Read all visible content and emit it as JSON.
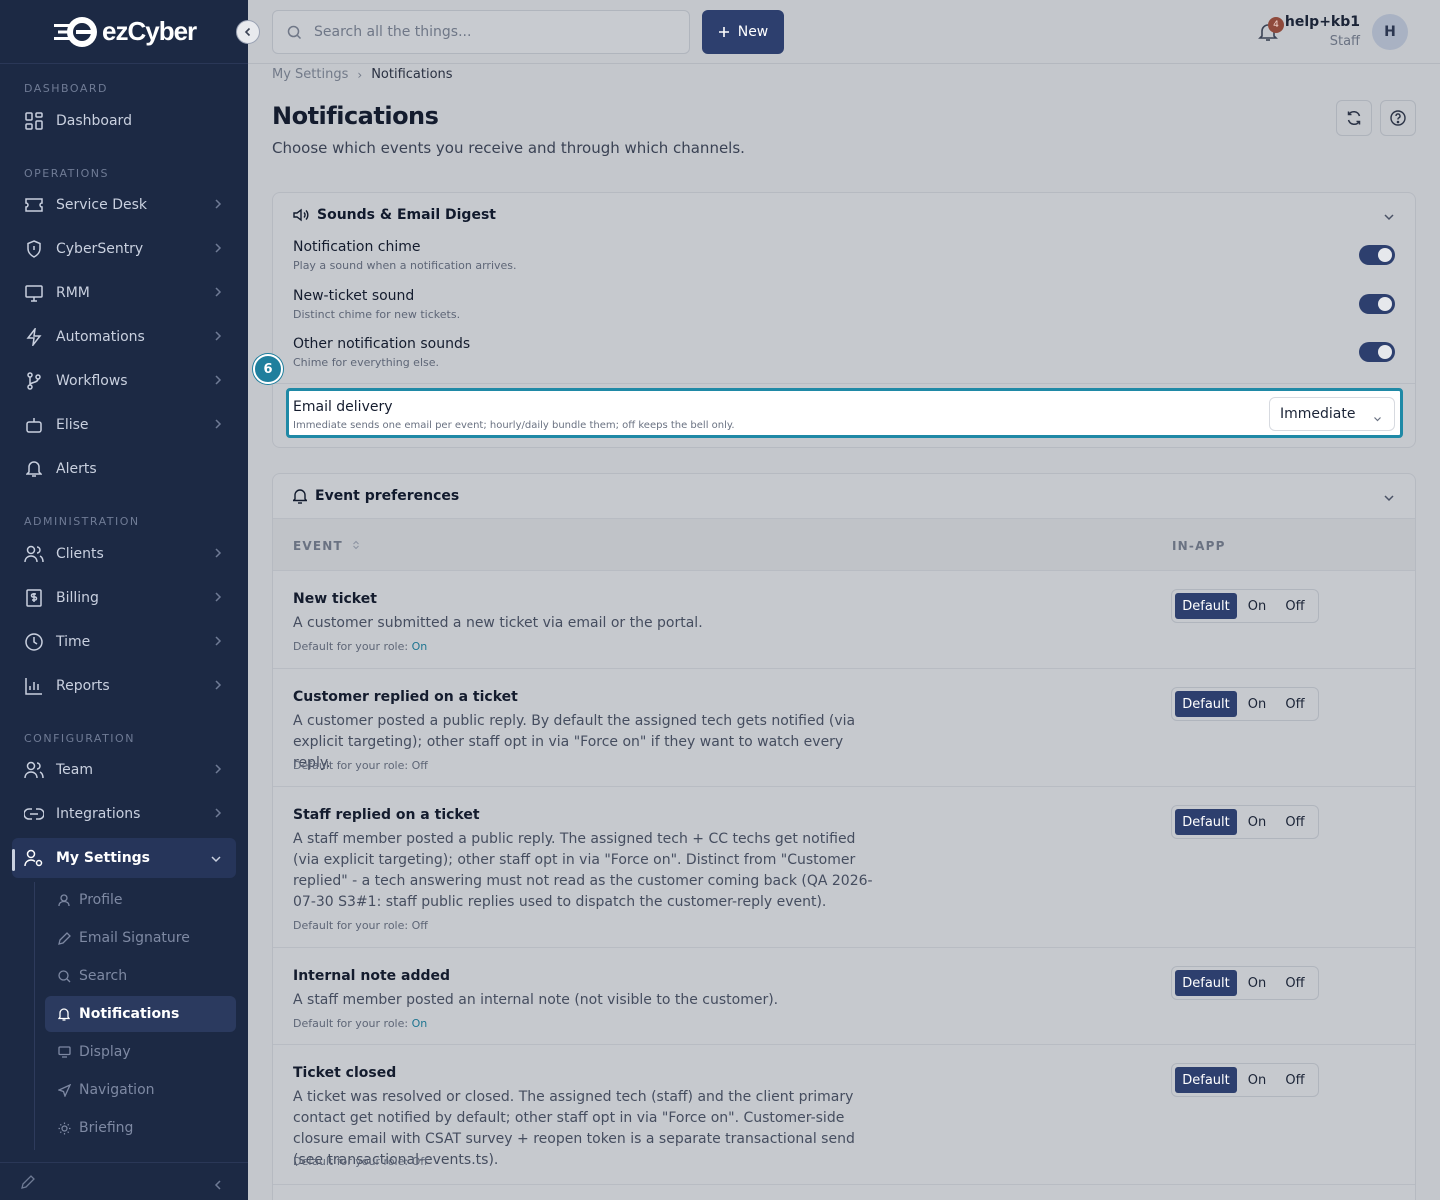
{
  "brand": {
    "name": "ezCyber"
  },
  "sidebar": {
    "sections": [
      {
        "label": "DASHBOARD"
      },
      {
        "label": "OPERATIONS"
      },
      {
        "label": "ADMINISTRATION"
      },
      {
        "label": "CONFIGURATION"
      }
    ],
    "items": [
      {
        "label": "Dashboard",
        "icon": "grid-icon"
      },
      {
        "label": "Service Desk",
        "icon": "ticket-icon"
      },
      {
        "label": "CyberSentry",
        "icon": "shield-icon"
      },
      {
        "label": "RMM",
        "icon": "monitor-icon"
      },
      {
        "label": "Automations",
        "icon": "bolt-icon"
      },
      {
        "label": "Workflows",
        "icon": "branch-icon"
      },
      {
        "label": "Elise",
        "icon": "bot-icon"
      },
      {
        "label": "Alerts",
        "icon": "bell-icon"
      },
      {
        "label": "Clients",
        "icon": "users-icon"
      },
      {
        "label": "Billing",
        "icon": "dollar-icon"
      },
      {
        "label": "Time",
        "icon": "clock-icon"
      },
      {
        "label": "Reports",
        "icon": "bar-chart-icon"
      },
      {
        "label": "Team",
        "icon": "team-icon"
      },
      {
        "label": "Integrations",
        "icon": "link-icon"
      },
      {
        "label": "My Settings",
        "icon": "user-cog-icon"
      }
    ],
    "subitems": [
      {
        "label": "Profile",
        "icon": "user-icon"
      },
      {
        "label": "Email Signature",
        "icon": "pen-icon"
      },
      {
        "label": "Search",
        "icon": "search-icon"
      },
      {
        "label": "Notifications",
        "icon": "bell-icon"
      },
      {
        "label": "Display",
        "icon": "display-icon"
      },
      {
        "label": "Navigation",
        "icon": "send-icon"
      },
      {
        "label": "Briefing",
        "icon": "sun-icon"
      }
    ]
  },
  "topbar": {
    "search_placeholder": "Search all the things...",
    "new_label": "New",
    "notification_count": "4",
    "user_name": "help+kb1",
    "user_role": "Staff",
    "avatar_initial": "H"
  },
  "breadcrumb": {
    "parent": "My Settings",
    "current": "Notifications"
  },
  "page": {
    "title": "Notifications",
    "subtitle": "Choose which events you receive and through which channels."
  },
  "sounds": {
    "title": "Sounds & Email Digest",
    "settings": [
      {
        "title": "Notification chime",
        "desc": "Play a sound when a notification arrives.",
        "enabled": true
      },
      {
        "title": "New-ticket sound",
        "desc": "Distinct chime for new tickets.",
        "enabled": true
      },
      {
        "title": "Other notification sounds",
        "desc": "Chime for everything else.",
        "enabled": true
      }
    ],
    "email": {
      "title": "Email delivery",
      "desc": "Immediate sends one email per event; hourly/daily bundle them; off keeps the bell only.",
      "value": "Immediate"
    },
    "step_marker": "6"
  },
  "events": {
    "title": "Event preferences",
    "col_event": "EVENT",
    "col_inapp": "IN-APP",
    "options": {
      "default": "Default",
      "on": "On",
      "off": "Off"
    },
    "rows": [
      {
        "title": "New ticket",
        "desc": "A customer submitted a new ticket via email or the portal.",
        "role_label": "Default for your role:",
        "role_value": "On"
      },
      {
        "title": "Customer replied on a ticket",
        "desc": "A customer posted a public reply. By default the assigned tech gets notified (via explicit targeting); other staff opt in via \"Force on\" if they want to watch every reply.",
        "role_label": "Default for your role:",
        "role_value": "Off"
      },
      {
        "title": "Staff replied on a ticket",
        "desc": "A staff member posted a public reply. The assigned tech + CC techs get notified (via explicit targeting); other staff opt in via \"Force on\". Distinct from \"Customer replied\" - a tech answering must not read as the customer coming back (QA 2026-07-30 S3#1: staff public replies used to dispatch the customer-reply event).",
        "role_label": "Default for your role:",
        "role_value": "Off"
      },
      {
        "title": "Internal note added",
        "desc": "A staff member posted an internal note (not visible to the customer).",
        "role_label": "Default for your role:",
        "role_value": "On"
      },
      {
        "title": "Ticket closed",
        "desc": "A ticket was resolved or closed. The assigned tech (staff) and the client primary contact get notified by default; other staff opt in via \"Force on\". Customer-side closure email with CSAT survey + reopen token is a separate transactional send (see transactional-events.ts).",
        "role_label": "Default for your role:",
        "role_value": "Off"
      }
    ]
  },
  "colors": {
    "sidebar": "#1c2944",
    "accent": "#2d3f6e",
    "highlight": "#1f89a6",
    "on_text": "#1f7591"
  }
}
